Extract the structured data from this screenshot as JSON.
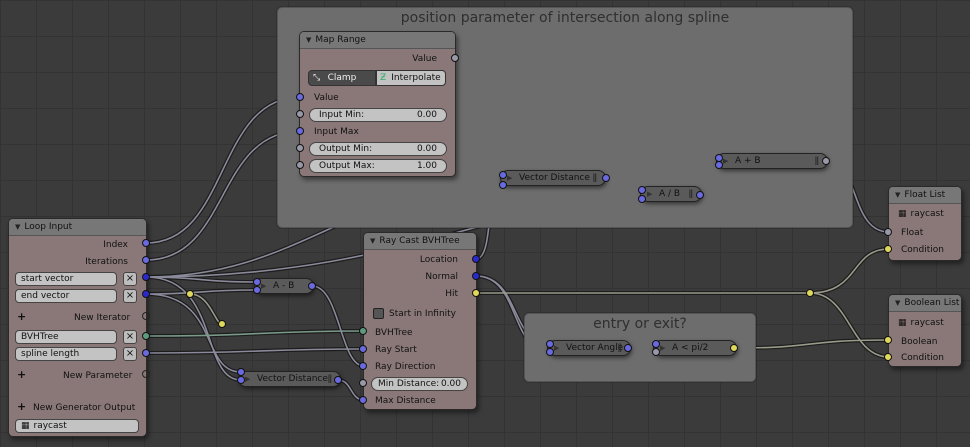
{
  "colors": {
    "canvas": "#3b3b3b",
    "node_body": "#8a7878",
    "frame": "#6d6d6d",
    "socket_vector": "#6a6ae0",
    "socket_float": "#9898a8",
    "socket_boolean": "#e0d85a",
    "socket_tree": "#5e9a7e"
  },
  "frames": {
    "spline": {
      "label": "position parameter of intersection along spline"
    },
    "entry": {
      "label": "entry or exit?"
    }
  },
  "map_range": {
    "title": "Map Range",
    "value_out": "Value",
    "clamp": "Clamp",
    "interpolate": "Interpolate",
    "value_in": "Value",
    "input_min_label": "Input Min:",
    "input_min": "0.00",
    "input_max": "Input Max",
    "output_min_label": "Output Min:",
    "output_min": "0.00",
    "output_max_label": "Output Max:",
    "output_max": "1.00"
  },
  "loop_input": {
    "title": "Loop Input",
    "index": "Index",
    "iterations": "Iterations",
    "start_vector": "start vector",
    "end_vector": "end vector",
    "new_iterator": "New Iterator",
    "bvhtree": "BVHTree",
    "spline_length": "spline length",
    "new_parameter": "New Parameter",
    "new_generator_output": "New Generator Output",
    "generator": "raycast"
  },
  "raycast": {
    "title": "Ray Cast BVHTree",
    "location": "Location",
    "normal": "Normal",
    "hit": "Hit",
    "start_in_infinity": "Start in Infinity",
    "bvhtree": "BVHTree",
    "ray_start": "Ray Start",
    "ray_direction": "Ray Direction",
    "min_distance_label": "Min Distance:",
    "min_distance": "0.00",
    "max_distance": "Max Distance"
  },
  "pills": {
    "vector_distance_top": "Vector Distance",
    "divide": "A / B",
    "add": "A + B",
    "subtract": "A - B",
    "vector_distance_bottom": "Vector Distance",
    "vector_angle": "Vector Angle",
    "compare": "A < pi/2"
  },
  "float_list": {
    "title": "Float List",
    "generator": "raycast",
    "type": "Float",
    "condition": "Condition"
  },
  "boolean_list": {
    "title": "Boolean List",
    "generator": "raycast",
    "type": "Boolean",
    "condition": "Condition"
  },
  "icons": {
    "node_collapse": "triangle-down-icon",
    "clamp": "clamp-icon",
    "interpolate": "interpolate-icon",
    "remove": "x-icon",
    "add": "plus-icon",
    "generator": "generator-icon",
    "drag": "drag-bars-icon"
  }
}
